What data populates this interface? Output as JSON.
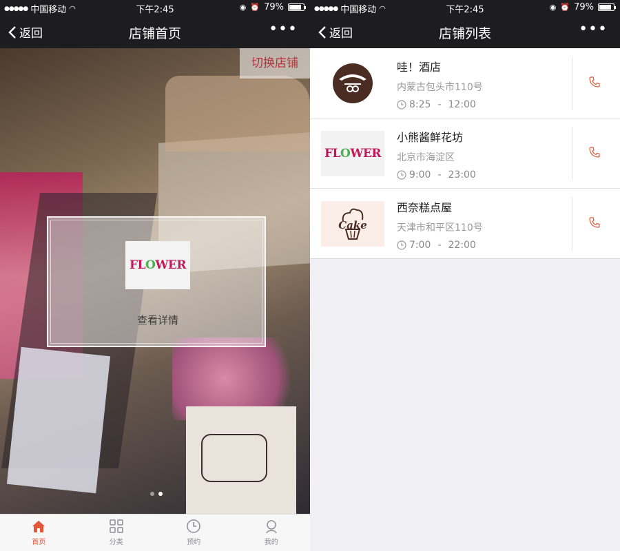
{
  "status": {
    "carrier": "中国移动",
    "time": "下午2:45",
    "battery": "79%",
    "battery_level": 0.79
  },
  "home": {
    "nav": {
      "back": "返回",
      "title": "店铺首页",
      "more": "•••"
    },
    "switch_store": "切换店铺",
    "card": {
      "logo_text_pre": "FL",
      "logo_text_o": "O",
      "logo_text_post": "WER",
      "link": "查看详情"
    },
    "carousel": {
      "pages": 2,
      "active": 2
    },
    "tabs": [
      {
        "label": "首页",
        "icon": "home-icon"
      },
      {
        "label": "分类",
        "icon": "grid-icon"
      },
      {
        "label": "预约",
        "icon": "clock-icon"
      },
      {
        "label": "我的",
        "icon": "user-icon"
      }
    ]
  },
  "list": {
    "nav": {
      "back": "返回",
      "title": "店铺列表",
      "more": "•••"
    },
    "stores": [
      {
        "name": "哇！酒店",
        "address": "内蒙古包头市110号",
        "open": "8:25",
        "close": "12:00",
        "logo": "hotel-logo"
      },
      {
        "name": "小熊酱鲜花坊",
        "address": "北京市海淀区",
        "open": "9:00",
        "close": "23:00",
        "logo": "flower-logo"
      },
      {
        "name": "西奈糕点屋",
        "address": "天津市和平区110号",
        "open": "7:00",
        "close": "22:00",
        "logo": "cake-logo"
      }
    ],
    "hours_separator": "-",
    "logo_text": {
      "flower_pre": "FL",
      "flower_o": "O",
      "flower_post": "WER",
      "cake": "Cake"
    }
  },
  "colors": {
    "accent": "#e0573a",
    "brand_red": "#b5333d",
    "bar_bg": "#1d1d1f"
  }
}
